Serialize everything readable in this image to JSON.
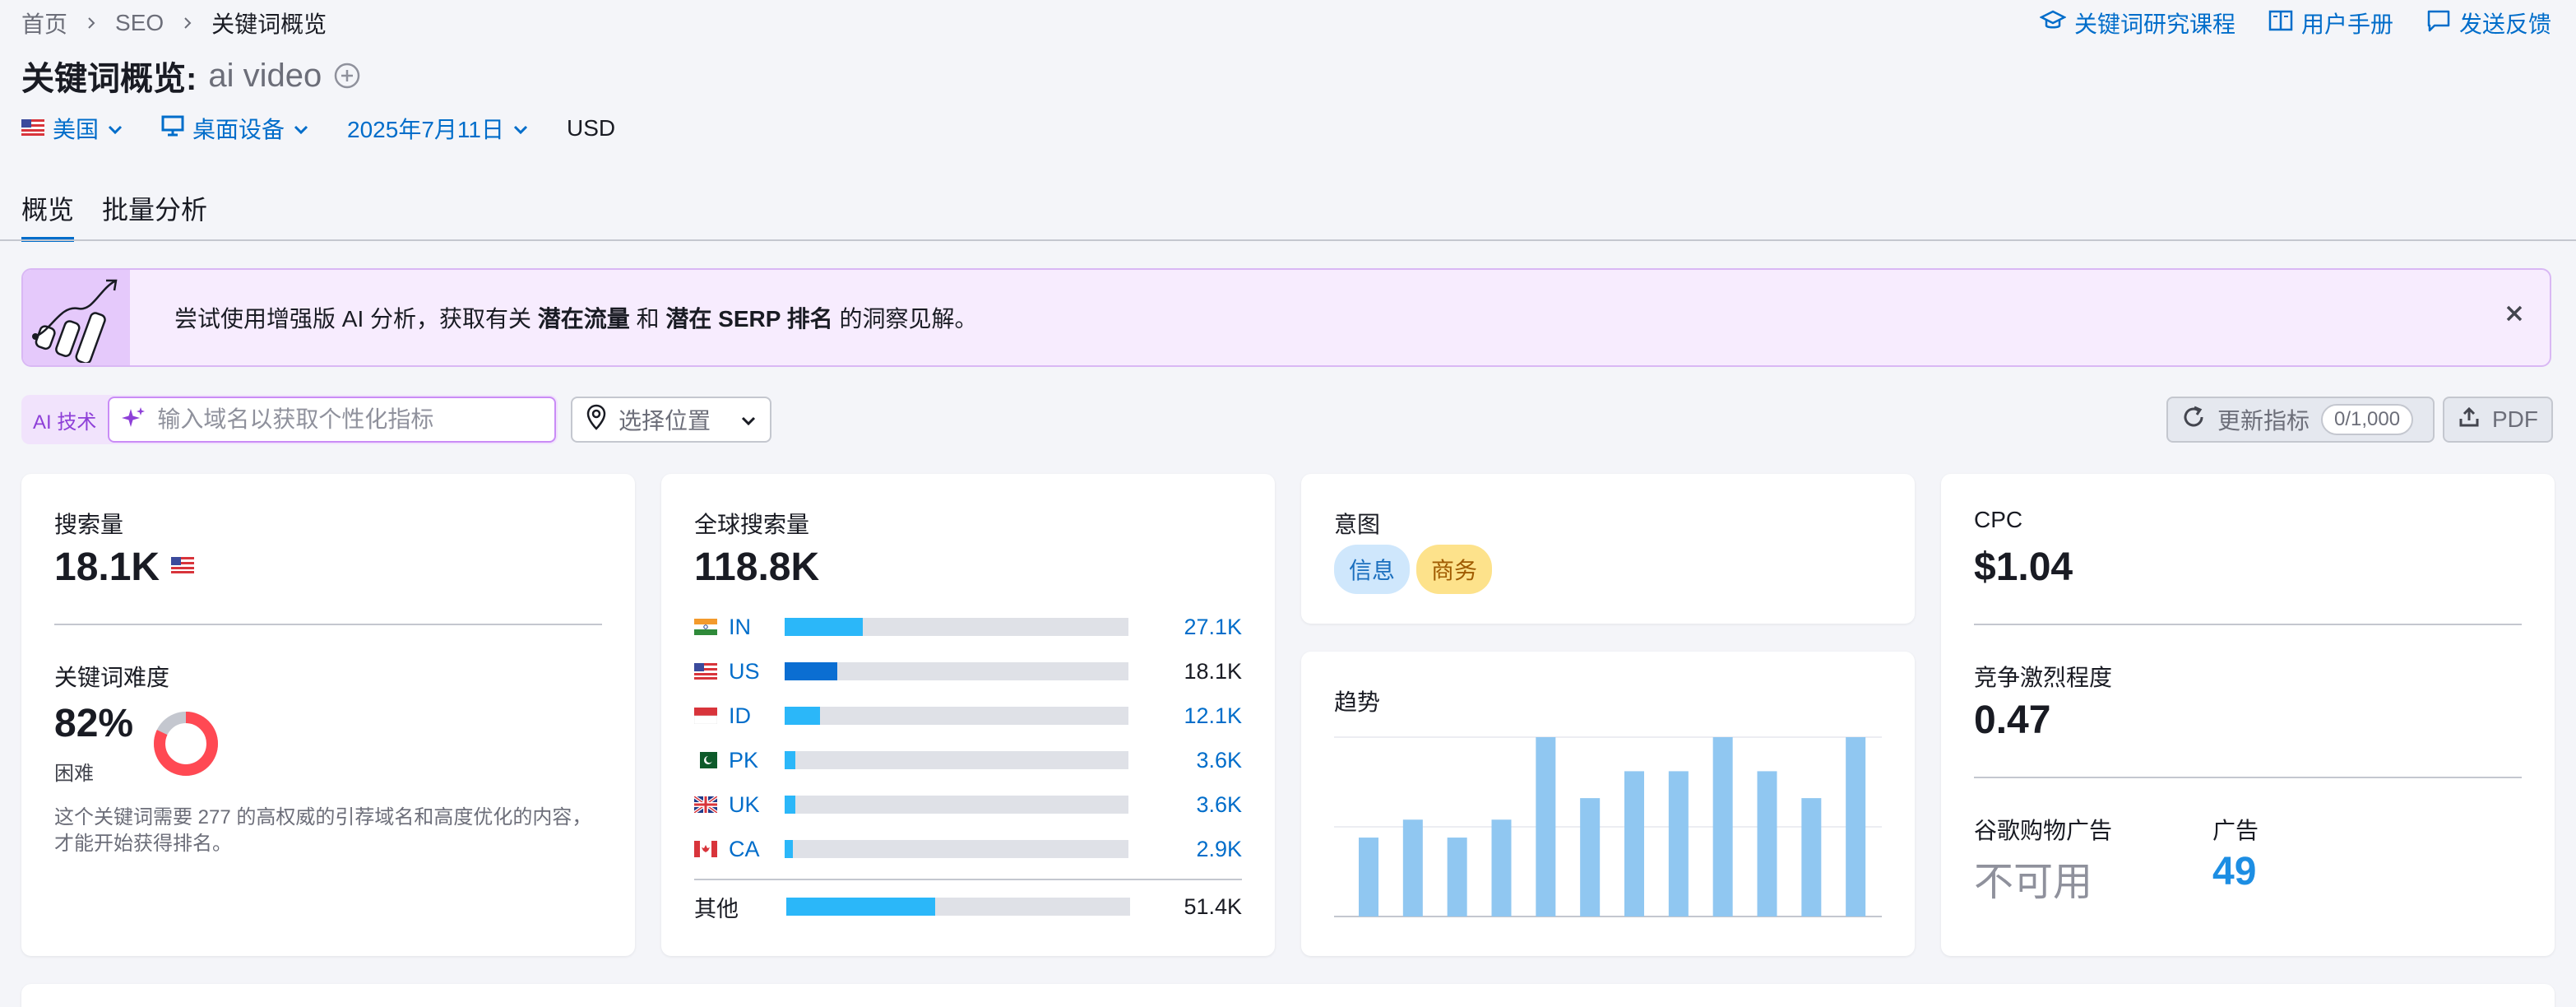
{
  "breadcrumb": {
    "items": [
      "首页",
      "SEO",
      "关键词概览"
    ]
  },
  "top_links": {
    "course": "关键词研究课程",
    "manual": "用户手册",
    "feedback": "发送反馈"
  },
  "header": {
    "title": "关键词概览:",
    "keyword": "ai video"
  },
  "filters": {
    "country": "美国",
    "device": "桌面设备",
    "date": "2025年7月11日",
    "currency": "USD"
  },
  "tabs": [
    "概览",
    "批量分析"
  ],
  "banner": {
    "text_before": "尝试使用增强版 AI 分析，获取有关 ",
    "bold1": "潜在流量",
    "text_mid": " 和 ",
    "bold2": "潜在 SERP 排名",
    "text_after": " 的洞察见解。"
  },
  "ai": {
    "tag": "AI 技术",
    "placeholder": "输入域名以获取个性化指标"
  },
  "location": {
    "label": "选择位置"
  },
  "actions": {
    "update_label": "更新指标",
    "update_count": "0/1,000",
    "pdf_label": "PDF"
  },
  "volume": {
    "label": "搜索量",
    "value": "18.1K"
  },
  "kd": {
    "label": "关键词难度",
    "value": "82%",
    "level": "困难",
    "percent": 82,
    "desc_line1": "这个关键词需要 277 的高权威的引荐域名和高度优化的内容，",
    "desc_line2": "才能开始获得排名。",
    "colors": {
      "fill": "#ff4953",
      "track": "#c4c7cf"
    }
  },
  "global_volume": {
    "label": "全球搜索量",
    "value": "118.8K",
    "countries": [
      {
        "code": "IN",
        "value": "27.1K",
        "share": 0.228,
        "bar_color": "#2bb7f9",
        "linked": true
      },
      {
        "code": "US",
        "value": "18.1K",
        "share": 0.152,
        "bar_color": "#0b6ed2",
        "linked": false
      },
      {
        "code": "ID",
        "value": "12.1K",
        "share": 0.102,
        "bar_color": "#2bb7f9",
        "linked": true
      },
      {
        "code": "PK",
        "value": "3.6K",
        "share": 0.03,
        "bar_color": "#2bb7f9",
        "linked": true
      },
      {
        "code": "UK",
        "value": "3.6K",
        "share": 0.03,
        "bar_color": "#2bb7f9",
        "linked": true
      },
      {
        "code": "CA",
        "value": "2.9K",
        "share": 0.024,
        "bar_color": "#2bb7f9",
        "linked": true
      }
    ],
    "other": {
      "label": "其他",
      "value": "51.4K",
      "share": 0.433
    }
  },
  "intent": {
    "label": "意图",
    "tags": [
      "信息",
      "商务"
    ]
  },
  "trend": {
    "label": "趋势",
    "bar_color": "#90c7f1"
  },
  "chart_data": {
    "type": "bar",
    "title": "趋势",
    "values": [
      0.44,
      0.54,
      0.44,
      0.54,
      1.0,
      0.66,
      0.81,
      0.81,
      1.0,
      0.81,
      0.66,
      1.0
    ],
    "ylim": [
      0,
      1
    ],
    "grid": true
  },
  "cpc": {
    "label": "CPC",
    "value": "$1.04"
  },
  "competition": {
    "label": "竞争激烈程度",
    "value": "0.47"
  },
  "shopping": {
    "label": "谷歌购物广告",
    "value": "不可用"
  },
  "ads": {
    "label": "广告",
    "value": "49",
    "color": "#1d8ee3"
  }
}
